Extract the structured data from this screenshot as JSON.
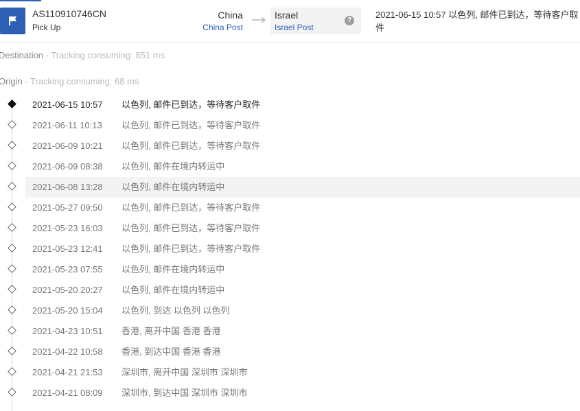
{
  "shipment": {
    "tracking_number": "AS110910746CN",
    "status": "Pick Up",
    "origin": {
      "country": "China",
      "carrier": "China Post"
    },
    "destination": {
      "country": "Israel",
      "carrier": "Israel Post"
    },
    "help_glyph": "?",
    "latest_event": "2021-06-15 10:57 以色列, 邮件已到达，等待客户取件"
  },
  "sections": {
    "destination": {
      "name": "Destination",
      "info": " - Tracking consuming: 851 ms"
    },
    "origin": {
      "name": "Origin",
      "info": " - Tracking consuming: 68 ms"
    }
  },
  "events": [
    {
      "time": "2021-06-15 10:57",
      "desc": "以色列, 邮件已到达，等待客户取件"
    },
    {
      "time": "2021-06-11 10:13",
      "desc": "以色列, 邮件已到达，等待客户取件"
    },
    {
      "time": "2021-06-09 10:21",
      "desc": "以色列, 邮件已到达，等待客户取件"
    },
    {
      "time": "2021-06-09 08:38",
      "desc": "以色列, 邮件在境内转运中"
    },
    {
      "time": "2021-06-08 13:28",
      "desc": "以色列, 邮件在境内转运中"
    },
    {
      "time": "2021-05-27 09:50",
      "desc": "以色列, 邮件已到达，等待客户取件"
    },
    {
      "time": "2021-05-23 16:03",
      "desc": "以色列, 邮件已到达，等待客户取件"
    },
    {
      "time": "2021-05-23 12:41",
      "desc": "以色列, 邮件已到达，等待客户取件"
    },
    {
      "time": "2021-05-23 07:55",
      "desc": "以色列, 邮件在境内转运中"
    },
    {
      "time": "2021-05-20 20:27",
      "desc": "以色列, 邮件在境内转运中"
    },
    {
      "time": "2021-05-20 15:04",
      "desc": "以色列, 到达 以色列 以色列"
    },
    {
      "time": "2021-04-23 10:51",
      "desc": "香港, 离开中国 香港 香港"
    },
    {
      "time": "2021-04-22 10:58",
      "desc": "香港, 到达中国 香港 香港"
    },
    {
      "time": "2021-04-21 21:53",
      "desc": "深圳市, 离开中国 深圳市 深圳市"
    },
    {
      "time": "2021-04-21 08:09",
      "desc": "深圳市, 到达中国 深圳市 深圳市"
    }
  ],
  "colors": {
    "accent": "#2d5fb4",
    "carrier_link": "#2d63b6",
    "highlight_row": "#f3f3f3"
  },
  "icons": {
    "status": "flag-icon",
    "route": "arrow-right-icon",
    "help": "question-circle-icon",
    "event_current": "diamond-filled-icon",
    "event": "diamond-outline-icon"
  }
}
